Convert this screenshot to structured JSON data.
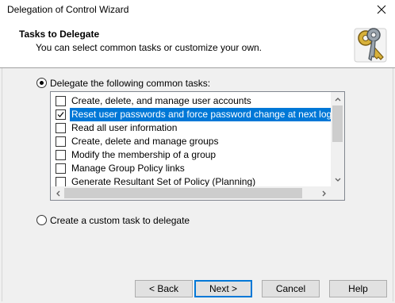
{
  "window": {
    "title": "Delegation of Control Wizard"
  },
  "header": {
    "title": "Tasks to Delegate",
    "subtitle": "You can select common tasks or customize your own."
  },
  "options": {
    "common_label": "Delegate the following common tasks:",
    "custom_label": "Create a custom task to delegate",
    "selected": "common"
  },
  "tasks": [
    {
      "label": "Create, delete, and manage user accounts",
      "checked": false
    },
    {
      "label": "Reset user passwords and force password change at next logon",
      "checked": true,
      "selected": true
    },
    {
      "label": "Read all user information",
      "checked": false
    },
    {
      "label": "Create, delete and manage groups",
      "checked": false
    },
    {
      "label": "Modify the membership of a group",
      "checked": false
    },
    {
      "label": "Manage Group Policy links",
      "checked": false
    },
    {
      "label": "Generate Resultant Set of Policy (Planning)",
      "checked": false
    }
  ],
  "buttons": {
    "back": "< Back",
    "next": "Next >",
    "cancel": "Cancel",
    "help": "Help"
  },
  "icons": {
    "close": "close-icon",
    "keys": "keys-icon",
    "check": "checkmark-icon"
  },
  "colors": {
    "selection": "#0078d7",
    "default_button_border": "#0078d7"
  }
}
